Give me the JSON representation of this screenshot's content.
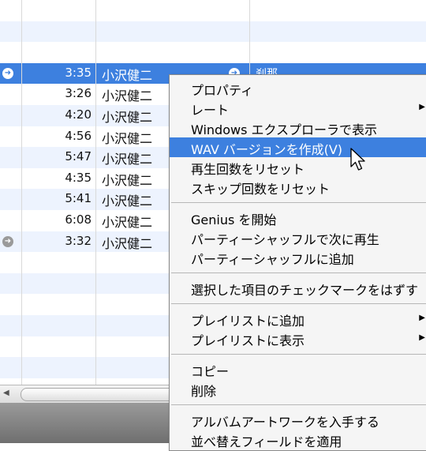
{
  "tracks": [
    {
      "time": "3:35",
      "artist": "小沢健二",
      "album": "刹那",
      "selected": true,
      "arrow": true
    },
    {
      "time": "3:26",
      "artist": "小沢健二",
      "album": "",
      "selected": false,
      "arrow": false
    },
    {
      "time": "4:20",
      "artist": "小沢健二",
      "album": "",
      "selected": false,
      "arrow": false
    },
    {
      "time": "4:56",
      "artist": "小沢健二",
      "album": "",
      "selected": false,
      "arrow": false
    },
    {
      "time": "5:47",
      "artist": "小沢健二",
      "album": "",
      "selected": false,
      "arrow": false
    },
    {
      "time": "4:35",
      "artist": "小沢健二",
      "album": "",
      "selected": false,
      "arrow": false
    },
    {
      "time": "5:41",
      "artist": "小沢健二",
      "album": "",
      "selected": false,
      "arrow": false
    },
    {
      "time": "6:08",
      "artist": "小沢健二",
      "album": "",
      "selected": false,
      "arrow": false
    },
    {
      "time": "3:32",
      "artist": "小沢健二",
      "album": "",
      "selected": false,
      "arrow": true
    }
  ],
  "context_menu": {
    "items": [
      {
        "label": "プロパティ"
      },
      {
        "label": "レート",
        "submenu": true
      },
      {
        "label": "Windows エクスプローラで表示"
      },
      {
        "label": "WAV バージョンを作成(V)",
        "highlighted": true
      },
      {
        "label": "再生回数をリセット"
      },
      {
        "label": "スキップ回数をリセット"
      },
      {
        "separator": true
      },
      {
        "label": "Genius を開始"
      },
      {
        "label": "パーティーシャッフルで次に再生"
      },
      {
        "label": "パーティーシャッフルに追加"
      },
      {
        "separator": true
      },
      {
        "label": "選択した項目のチェックマークをはずす"
      },
      {
        "separator": true
      },
      {
        "label": "プレイリストに追加",
        "submenu": true
      },
      {
        "label": "プレイリストに表示",
        "submenu": true
      },
      {
        "separator": true
      },
      {
        "label": "コピー"
      },
      {
        "label": "削除"
      },
      {
        "separator": true
      },
      {
        "label": "アルバムアートワークを入手する"
      },
      {
        "label": "並べ替えフィールドを適用"
      }
    ]
  },
  "icons": {
    "row_arrow": "➜",
    "submenu_arrow": "▶",
    "scroll_left": "◀"
  },
  "colors": {
    "selection": "#3d80df",
    "row_stripe": "#edf3fe",
    "menu_bg": "#f5f5f5"
  }
}
